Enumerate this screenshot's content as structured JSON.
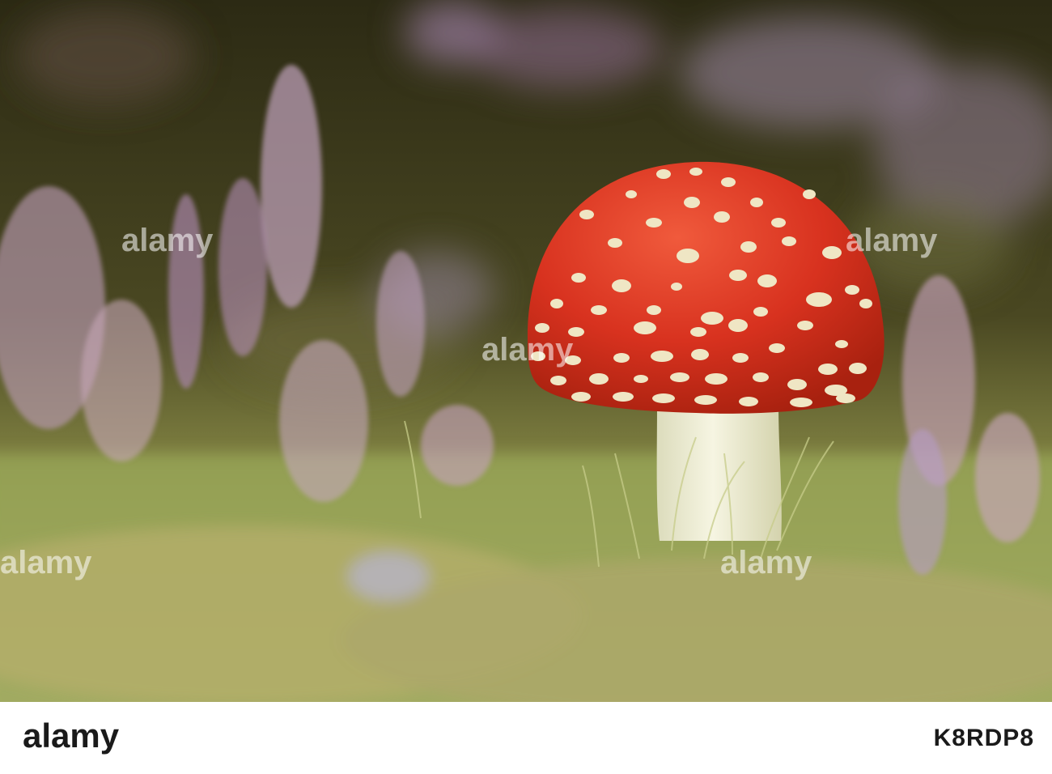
{
  "watermark": {
    "brand": "alamy"
  },
  "footer": {
    "logo_text": "alamy",
    "image_id": "K8RDP8"
  },
  "colors": {
    "cap_red": "#d8321f",
    "spot_cream": "#efe6c4",
    "stem_white": "#f1f0da",
    "heather_pink": "#c89bc0",
    "grass_green": "#9aa85a",
    "background_dark": "#2e2a17"
  }
}
